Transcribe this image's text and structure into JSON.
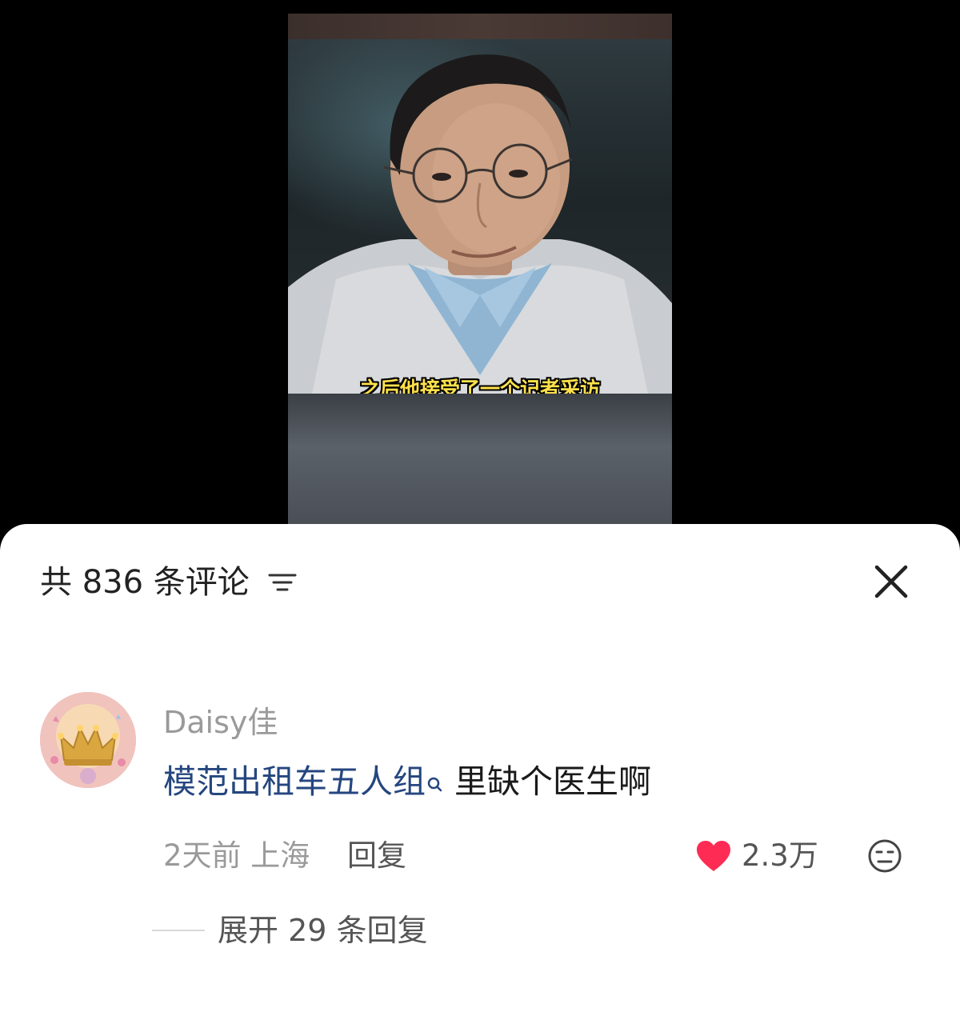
{
  "video": {
    "subtitle": "之后他接受了一个记者采访"
  },
  "comments_panel": {
    "count_label": "共 836 条评论",
    "sort_icon": "sort-icon",
    "close_icon": "close-icon"
  },
  "comment": {
    "username": "Daisy佳",
    "avatar_icon": "crown-avatar",
    "text_link": "模范出租车五人组",
    "link_icon": "search-icon",
    "text_rest": "里缺个医生啊",
    "time_location": "2天前 上海",
    "reply_label": "回复",
    "like_count": "2.3万",
    "liked": true,
    "like_color": "#fe2c55",
    "dislike_icon": "dislike-face-icon",
    "expand_label": "展开 29 条回复"
  },
  "colors": {
    "link": "#25467f",
    "meta": "#9a9a9a",
    "subtitle": "#ffe14a"
  }
}
